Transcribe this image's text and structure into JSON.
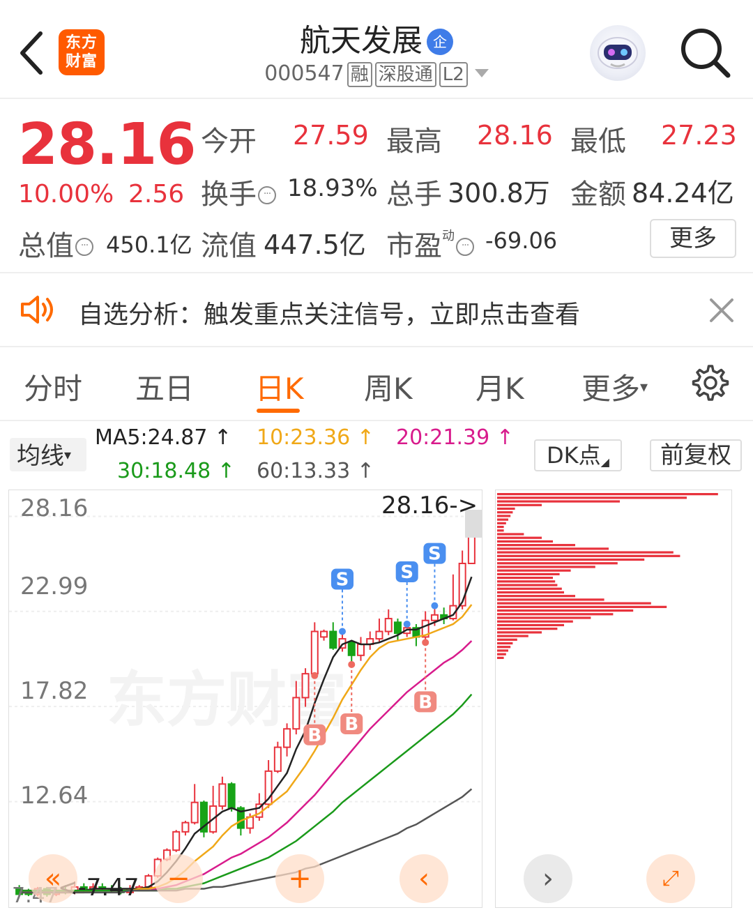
{
  "header": {
    "logo_line1": "东方",
    "logo_line2": "财富",
    "stock_name": "航天发展",
    "company_badge": "企",
    "code": "000547",
    "tags": [
      "融",
      "深股通",
      "L2"
    ]
  },
  "quote": {
    "price": "28.16",
    "change_pct": "10.00%",
    "change_amt": "2.56",
    "open_label": "今开",
    "open_value": "27.59",
    "high_label": "最高",
    "high_value": "28.16",
    "low_label": "最低",
    "low_value": "27.23",
    "turnover_label": "换手",
    "turnover_value": "18.93%",
    "volume_label": "总手",
    "volume_value": "300.8万",
    "amount_label": "金额",
    "amount_value": "84.24亿",
    "mktcap_label": "总值",
    "mktcap_value": "450.1亿",
    "float_label": "流值",
    "float_value": "447.5亿",
    "pe_label": "市盈",
    "pe_sup": "动",
    "pe_value": "-69.06",
    "more_label": "更多"
  },
  "alert": {
    "text": "自选分析：触发重点关注信号，立即点击查看"
  },
  "tabs": [
    "分时",
    "五日",
    "日K",
    "周K",
    "月K",
    "更多"
  ],
  "active_tab": "日K",
  "indicators": {
    "ma_select": "均线",
    "ma5": "MA5:24.87",
    "ma10": "10:23.36",
    "ma20": "20:21.39",
    "ma30": "30:18.48",
    "ma60": "60:13.33",
    "dk_label": "DK点",
    "adjust_label": "前复权",
    "colors": {
      "ma5": "#222222",
      "ma10": "#f0a818",
      "ma20": "#d81b8c",
      "ma30": "#1a9a1a",
      "ma60": "#555555",
      "up": "#e8323c",
      "down": "#17a317"
    }
  },
  "chart_data": {
    "type": "candlestick",
    "ylim": [
      7.2,
      28.9
    ],
    "y_ticks": [
      "28.16",
      "22.99",
      "17.82",
      "12.64",
      "7.47"
    ],
    "high_marker": "28.16->",
    "low_marker": "<-7.47",
    "candles": [
      [
        7.9,
        7.6,
        8.1,
        7.5
      ],
      [
        7.7,
        7.6,
        7.9,
        7.5
      ],
      [
        7.6,
        7.9,
        8.0,
        7.5
      ],
      [
        7.9,
        7.6,
        8.0,
        7.47
      ],
      [
        7.6,
        7.8,
        8.0,
        7.5
      ],
      [
        7.8,
        7.7,
        8.1,
        7.6
      ],
      [
        7.7,
        8.0,
        8.3,
        7.6
      ],
      [
        8.0,
        7.9,
        8.2,
        7.7
      ],
      [
        7.9,
        8.0,
        8.2,
        7.8
      ],
      [
        8.0,
        7.9,
        8.2,
        7.8
      ],
      [
        7.9,
        7.8,
        8.1,
        7.7
      ],
      [
        7.8,
        7.7,
        8.0,
        7.6
      ],
      [
        7.7,
        7.9,
        8.1,
        7.6
      ],
      [
        7.9,
        8.0,
        8.1,
        7.8
      ],
      [
        8.0,
        8.6,
        8.7,
        7.9
      ],
      [
        8.6,
        9.5,
        9.6,
        8.5
      ],
      [
        9.5,
        10.0,
        10.1,
        9.4
      ],
      [
        10.0,
        11.0,
        11.1,
        9.9
      ],
      [
        11.0,
        11.5,
        11.6,
        10.8
      ],
      [
        11.5,
        12.6,
        13.6,
        11.4
      ],
      [
        12.6,
        11.0,
        12.7,
        10.7
      ],
      [
        11.0,
        12.4,
        13.5,
        10.9
      ],
      [
        12.4,
        13.6,
        14.0,
        12.2
      ],
      [
        13.6,
        12.3,
        13.7,
        12.1
      ],
      [
        12.3,
        11.2,
        12.4,
        10.8
      ],
      [
        11.2,
        11.8,
        12.0,
        10.9
      ],
      [
        11.8,
        12.5,
        13.1,
        11.6
      ],
      [
        12.5,
        14.3,
        14.9,
        12.3
      ],
      [
        14.3,
        15.6,
        15.9,
        14.2
      ],
      [
        15.6,
        16.6,
        16.9,
        15.1
      ],
      [
        16.6,
        18.3,
        19.2,
        16.3
      ],
      [
        18.3,
        19.6,
        19.9,
        17.8
      ],
      [
        19.6,
        21.9,
        22.4,
        19.5
      ],
      [
        21.6,
        21.9,
        22.0,
        21.4
      ],
      [
        21.9,
        21.0,
        22.4,
        20.9
      ],
      [
        21.0,
        21.5,
        21.9,
        20.8
      ],
      [
        21.3,
        20.6,
        21.4,
        20.1
      ],
      [
        20.6,
        21.2,
        21.6,
        20.3
      ],
      [
        21.2,
        21.5,
        21.9,
        20.9
      ],
      [
        21.5,
        21.9,
        22.6,
        21.3
      ],
      [
        21.9,
        22.6,
        23.1,
        21.7
      ],
      [
        22.4,
        21.8,
        22.6,
        21.4
      ],
      [
        21.8,
        22.1,
        22.3,
        21.6
      ],
      [
        22.1,
        21.6,
        22.3,
        21.1
      ],
      [
        21.6,
        22.5,
        23.0,
        21.3
      ],
      [
        22.5,
        22.8,
        23.3,
        22.2
      ],
      [
        22.8,
        22.6,
        23.2,
        22.3
      ],
      [
        22.6,
        23.3,
        25.0,
        22.5
      ],
      [
        23.3,
        25.6,
        26.3,
        23.1
      ],
      [
        25.6,
        28.16,
        28.16,
        27.23
      ]
    ],
    "signals": [
      {
        "type": "S",
        "index": 35
      },
      {
        "type": "S",
        "index": 42
      },
      {
        "type": "S",
        "index": 45
      },
      {
        "type": "B",
        "index": 32
      },
      {
        "type": "B",
        "index": 36
      },
      {
        "type": "B",
        "index": 44
      }
    ],
    "ma_lines": {
      "ma5": [
        7.7,
        7.7,
        7.7,
        7.7,
        7.7,
        7.7,
        7.8,
        7.8,
        7.9,
        7.9,
        7.9,
        7.9,
        7.9,
        7.9,
        8.0,
        8.3,
        8.8,
        9.4,
        10.1,
        10.9,
        11.3,
        11.7,
        12.1,
        12.3,
        12.1,
        12.2,
        12.3,
        12.8,
        13.5,
        14.2,
        15.5,
        16.5,
        18.0,
        19.3,
        20.5,
        21.2,
        21.4,
        21.2,
        21.2,
        21.3,
        21.5,
        21.7,
        22.0,
        22.0,
        22.2,
        22.4,
        22.6,
        22.8,
        23.5,
        24.87
      ],
      "ma10": [
        7.7,
        7.7,
        7.7,
        7.7,
        7.7,
        7.7,
        7.7,
        7.7,
        7.8,
        7.8,
        7.8,
        7.8,
        7.8,
        7.9,
        7.9,
        8.0,
        8.2,
        8.5,
        8.9,
        9.4,
        9.8,
        10.2,
        10.8,
        11.3,
        11.6,
        11.8,
        12.0,
        12.4,
        12.8,
        13.2,
        13.9,
        14.6,
        15.4,
        16.3,
        17.2,
        18.2,
        19.0,
        19.8,
        20.5,
        21.0,
        21.3,
        21.4,
        21.5,
        21.6,
        21.7,
        21.9,
        22.1,
        22.3,
        22.7,
        23.36
      ],
      "ma20": [
        7.8,
        7.8,
        7.8,
        7.8,
        7.8,
        7.8,
        7.8,
        7.8,
        7.8,
        7.8,
        7.8,
        7.8,
        7.8,
        7.8,
        7.8,
        7.9,
        8.0,
        8.1,
        8.3,
        8.5,
        8.7,
        9.0,
        9.3,
        9.6,
        9.8,
        10.1,
        10.4,
        10.7,
        11.1,
        11.5,
        12.0,
        12.5,
        13.0,
        13.6,
        14.2,
        14.8,
        15.4,
        16.0,
        16.6,
        17.1,
        17.6,
        18.1,
        18.6,
        19.0,
        19.4,
        19.8,
        20.2,
        20.5,
        20.9,
        21.39
      ],
      "ma30": [
        7.8,
        7.8,
        7.8,
        7.8,
        7.8,
        7.8,
        7.8,
        7.8,
        7.8,
        7.8,
        7.8,
        7.8,
        7.8,
        7.8,
        7.8,
        7.8,
        7.9,
        7.9,
        8.0,
        8.1,
        8.2,
        8.4,
        8.6,
        8.8,
        9.0,
        9.2,
        9.4,
        9.6,
        9.9,
        10.2,
        10.5,
        10.9,
        11.3,
        11.7,
        12.1,
        12.6,
        13.0,
        13.4,
        13.8,
        14.2,
        14.6,
        15.0,
        15.4,
        15.8,
        16.2,
        16.6,
        17.0,
        17.4,
        17.9,
        18.48
      ],
      "ma60": [
        7.7,
        7.7,
        7.7,
        7.7,
        7.7,
        7.7,
        7.7,
        7.7,
        7.7,
        7.7,
        7.7,
        7.7,
        7.8,
        7.8,
        7.8,
        7.8,
        7.8,
        7.8,
        7.9,
        7.9,
        7.9,
        8.0,
        8.0,
        8.1,
        8.2,
        8.3,
        8.4,
        8.5,
        8.6,
        8.7,
        8.8,
        9.0,
        9.1,
        9.3,
        9.5,
        9.7,
        9.9,
        10.1,
        10.3,
        10.5,
        10.7,
        10.9,
        11.2,
        11.4,
        11.7,
        12.0,
        12.3,
        12.6,
        12.9,
        13.33
      ]
    },
    "volume_profile": [
      0.99,
      0.85,
      0.55,
      0.2,
      0.08,
      0.07,
      0.06,
      0.05,
      0.04,
      0.03,
      0.03,
      0.12,
      0.2,
      0.25,
      0.35,
      0.5,
      0.79,
      0.82,
      0.66,
      0.54,
      0.44,
      0.33,
      0.28,
      0.25,
      0.26,
      0.27,
      0.29,
      0.3,
      0.35,
      0.48,
      0.69,
      0.76,
      0.61,
      0.52,
      0.42,
      0.34,
      0.3,
      0.27,
      0.2,
      0.14,
      0.09,
      0.07,
      0.06,
      0.05,
      0.04,
      0.03
    ]
  },
  "watermark": "东方财富"
}
